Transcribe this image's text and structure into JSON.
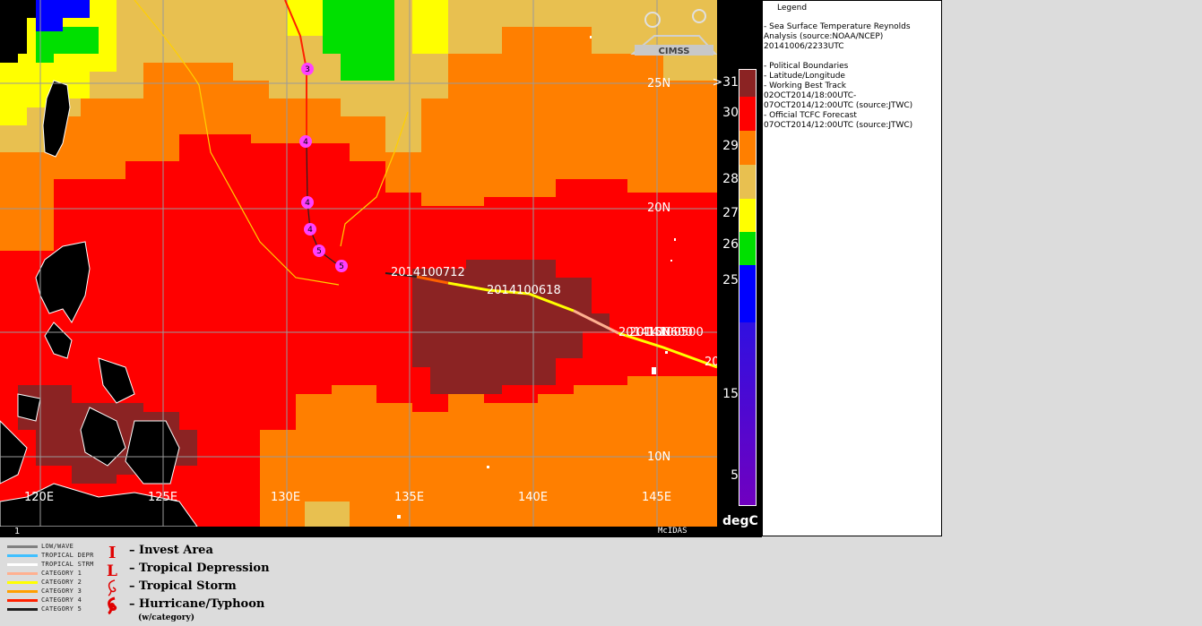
{
  "map": {
    "lat_labels": [
      "25N",
      "20N",
      "15N",
      "10N"
    ],
    "lon_labels": [
      "120E",
      "125E",
      "130E",
      "135E",
      "140E",
      "145E"
    ],
    "track_labels": [
      "2014100712",
      "2014100618",
      "2014100600",
      "2014100500"
    ],
    "track_label_partial": "20",
    "storm_categories": [
      "3",
      "4",
      "4",
      "4",
      "5",
      "5"
    ],
    "frame_number": "1",
    "software": "McIDAS",
    "logo_text": "CIMSS"
  },
  "colorbar": {
    "labels": [
      ">31",
      "30",
      "29",
      "28",
      "27",
      "26",
      "25",
      "15",
      "5"
    ],
    "unit": "degC",
    "colors": {
      "31": "#8b2323",
      "30": "#ff0000",
      "29": "#ff7f00",
      "28": "#e8c050",
      "27": "#ffff00",
      "26": "#00e000",
      "25": "#0000ff",
      "15": "#7000c0"
    }
  },
  "legend": {
    "title": "Legend",
    "lines": [
      "-  Sea Surface Temperature  Reynolds",
      "Analysis  (source:NOAA/NCEP)",
      "20141006/2233UTC",
      "",
      "-  Political Boundaries",
      "-  Latitude/Longitude",
      "-  Working Best Track",
      "02OCT2014/18:00UTC-",
      "07OCT2014/12:00UTC   (source:JTWC)",
      "-  Official TCFC Forecast",
      "07OCT2014/12:00UTC  (source:JTWC)"
    ]
  },
  "track_key": [
    {
      "label": "LOW/WAVE",
      "color": "#808080"
    },
    {
      "label": "TROPICAL DEPR",
      "color": "#40c0ff"
    },
    {
      "label": "TROPICAL STRM",
      "color": "#ffffff"
    },
    {
      "label": "CATEGORY 1",
      "color": "#ffb090"
    },
    {
      "label": "CATEGORY 2",
      "color": "#ffff00"
    },
    {
      "label": "CATEGORY 3",
      "color": "#ffa000"
    },
    {
      "label": "CATEGORY 4",
      "color": "#ff2000"
    },
    {
      "label": "CATEGORY 5",
      "color": "#202020"
    }
  ],
  "symbol_key": [
    {
      "label": "– Invest Area"
    },
    {
      "label": "– Tropical Depression"
    },
    {
      "label": "– Tropical Storm"
    },
    {
      "label": "– Hurricane/Typhoon"
    }
  ],
  "symbol_key_note": "(w/category)"
}
